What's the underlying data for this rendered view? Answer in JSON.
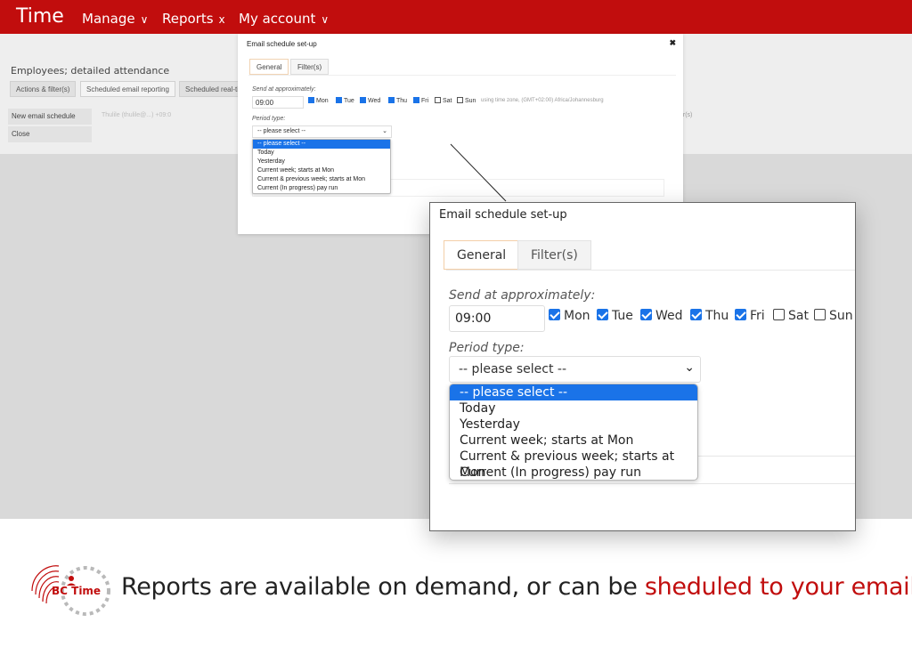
{
  "topbar": {
    "brand": "Time",
    "nav": [
      {
        "label": "Manage",
        "suffix": "∨"
      },
      {
        "label": "Reports",
        "suffix": "x"
      },
      {
        "label": "My account",
        "suffix": "∨"
      }
    ]
  },
  "background": {
    "page_title": "Employees; detailed attendance",
    "tabs": [
      "Actions & filter(s)",
      "Scheduled email reporting",
      "Scheduled real-ti"
    ],
    "side_buttons": [
      "New email schedule",
      "Close"
    ],
    "row_text": "Thulile (thulile@...) +09:0",
    "right_text": "er(s)"
  },
  "modal": {
    "title": "Email schedule set-up",
    "close": "✖",
    "tabs": [
      "General",
      "Filter(s)"
    ],
    "send_label": "Send at approximately:",
    "time": "09:00",
    "days": [
      {
        "label": "Mon",
        "checked": true
      },
      {
        "label": "Tue",
        "checked": true
      },
      {
        "label": "Wed",
        "checked": true
      },
      {
        "label": "Thu",
        "checked": true
      },
      {
        "label": "Fri",
        "checked": true
      },
      {
        "label": "Sat",
        "checked": false
      },
      {
        "label": "Sun",
        "checked": false
      }
    ],
    "timezone_text": "using time zone, (GMT+02:00) Africa/Johannesburg",
    "period_label": "Period type:",
    "period_selected": "-- please select --",
    "period_options": [
      "-- please select --",
      "Today",
      "Yesterday",
      "Current week; starts at Mon",
      "Current & previous week; starts at Mon",
      "Current (In progress) pay run"
    ]
  },
  "footer": {
    "logo_text": "BC Time",
    "text_plain": "Reports are available on demand, or can be ",
    "text_accent": "sheduled to your email"
  },
  "colors": {
    "brand_red": "#c10d0d",
    "select_blue": "#1a73e8"
  }
}
